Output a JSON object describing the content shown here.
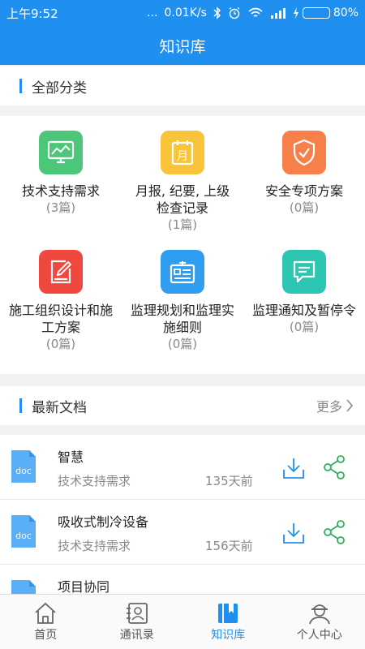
{
  "status_bar": {
    "time": "上午9:52",
    "dots": "...",
    "speed": "0.01K/s",
    "battery_text": "80%",
    "battery_level": 0.8
  },
  "header": {
    "title": "知识库"
  },
  "categories_section": {
    "title": "全部分类"
  },
  "categories": [
    {
      "label": "技术支持需求",
      "count": "(3篇)",
      "color": "#4cc77a",
      "icon": "chart-monitor-icon"
    },
    {
      "label": "月报, 纪要, 上级检查记录",
      "count": "(1篇)",
      "color": "#f9c43a",
      "icon": "calendar-icon"
    },
    {
      "label": "安全专项方案",
      "count": "(0篇)",
      "color": "#f7804a",
      "icon": "shield-check-icon"
    },
    {
      "label": "施工组织设计和施工方案",
      "count": "(0篇)",
      "color": "#f0473e",
      "icon": "edit-document-icon"
    },
    {
      "label": "监理规划和监理实施细则",
      "count": "(0篇)",
      "color": "#2f9df0",
      "icon": "id-card-icon"
    },
    {
      "label": "监理通知及暂停令",
      "count": "(0篇)",
      "color": "#2cc6b3",
      "icon": "message-icon"
    }
  ],
  "latest_section": {
    "title": "最新文档",
    "more": "更多"
  },
  "documents": [
    {
      "title": "智慧",
      "category": "技术支持需求",
      "time": "135天前",
      "file_type": "doc"
    },
    {
      "title": "吸收式制冷设备",
      "category": "技术支持需求",
      "time": "156天前",
      "file_type": "doc"
    },
    {
      "title": "项目协同",
      "category": "",
      "time": "",
      "file_type": "doc"
    }
  ],
  "tabs": [
    {
      "label": "首页",
      "icon": "home-icon",
      "active": false
    },
    {
      "label": "通讯录",
      "icon": "contacts-icon",
      "active": false
    },
    {
      "label": "知识库",
      "icon": "knowledge-base-icon",
      "active": true
    },
    {
      "label": "个人中心",
      "icon": "user-worker-icon",
      "active": false
    }
  ],
  "colors": {
    "primary": "#1f8ff0",
    "doc_icon": "#5aaef5"
  }
}
